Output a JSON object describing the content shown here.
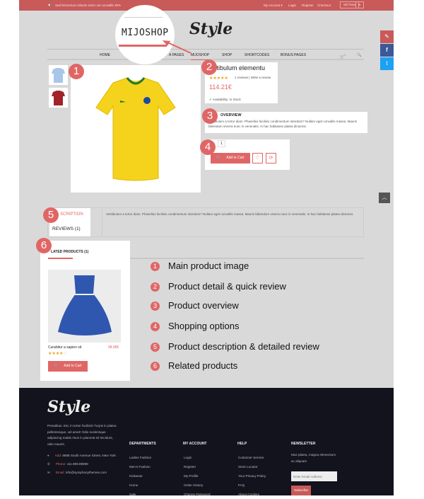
{
  "topbar": {
    "promo": "Sed fermentum loborts tortor vel convallis 30%",
    "my_account": "My Account ▾",
    "login": "Login",
    "register": "Register",
    "checkout": "Checkout",
    "setting": "SETTING"
  },
  "header": {
    "magnified_label": "MIJOSHOP",
    "logo": "Style"
  },
  "nav": {
    "items": [
      "HOME",
      "MIJOSHOP",
      "SHOP",
      "SHORTCODES",
      "BONUS PAGES"
    ],
    "partial": "A PAGES",
    "cart_count": "0"
  },
  "product": {
    "title": "stibulum elementu",
    "reviews": "1 reviews",
    "write_review": "Write a review",
    "price": "114.21€",
    "availability": "Availability: In Stock",
    "rating": 5
  },
  "overview": {
    "heading": "OVERVIEW",
    "text": "Vestibulum a tortor diam. Phasellus facilisis condimentum interdum? Nullam eget convallis massa. Mauris bibendum viverra nunc in venenatis. In hac habitasse platea dictumst."
  },
  "options": {
    "quantity": "1",
    "add_to_cart": "Add to Cart"
  },
  "tabs": {
    "description": "SCRIPTION",
    "reviews": "REVIEWS (1)",
    "content": "Vestibulum a tortor diam. Phasellus facilisis condimentum interdum? Nullam eget convallis massa. Mauris bibendum viverra nunc in venenatis. In hac habitasse platea dictumst."
  },
  "related": {
    "heading": "LATED PRODUCTS (1)",
    "name": "Curabitur a sapien sit",
    "price": "98.98€",
    "rating": 4,
    "add_to_cart": "Add to Cart"
  },
  "badges": [
    "1",
    "2",
    "3",
    "4",
    "5",
    "6"
  ],
  "legend": [
    "Main  product image",
    "Product detail & quick review",
    "Product overview",
    "Shopping options",
    "Product description & detailed review",
    "Related products"
  ],
  "footer": {
    "logo": "Style",
    "about": "Penatibus. Est, in tortor facilisis! Turpis in platea pellentesque, vel amet! Odio scelerisque adipiscing mattis risus in placerat sit tincidunt, odio mauris.",
    "addr_label": "Add:",
    "addr": "8888 South Avenue Street, New York",
    "phone_label": "Phone:",
    "phone": "111.999.99999",
    "email_label": "Email:",
    "email": "info@symphonythemes.com",
    "columns": [
      {
        "title": "DEPARTMENTS",
        "links": [
          "Ladies Fashion",
          "Men's Fashion",
          "Kidswear",
          "Home",
          "Sale"
        ]
      },
      {
        "title": "MY ACCOUNT",
        "links": [
          "Login",
          "Register",
          "My Profile",
          "Order History",
          "Change Password"
        ]
      },
      {
        "title": "HELP",
        "links": [
          "Customer Service",
          "Store Locator",
          "Your Privacy Policy",
          "FAQ",
          "About Cookies"
        ]
      }
    ],
    "newsletter": {
      "title": "NEWSLETTER",
      "text": "Mus platea, magna elementum ac aliquam",
      "placeholder": "Enter Email Address",
      "subscribe": "Subscribe"
    }
  },
  "colors": {
    "accent": "#e06666",
    "topbar": "#c85a5a",
    "footer": "#12131c",
    "page": "#d9d9d9"
  }
}
